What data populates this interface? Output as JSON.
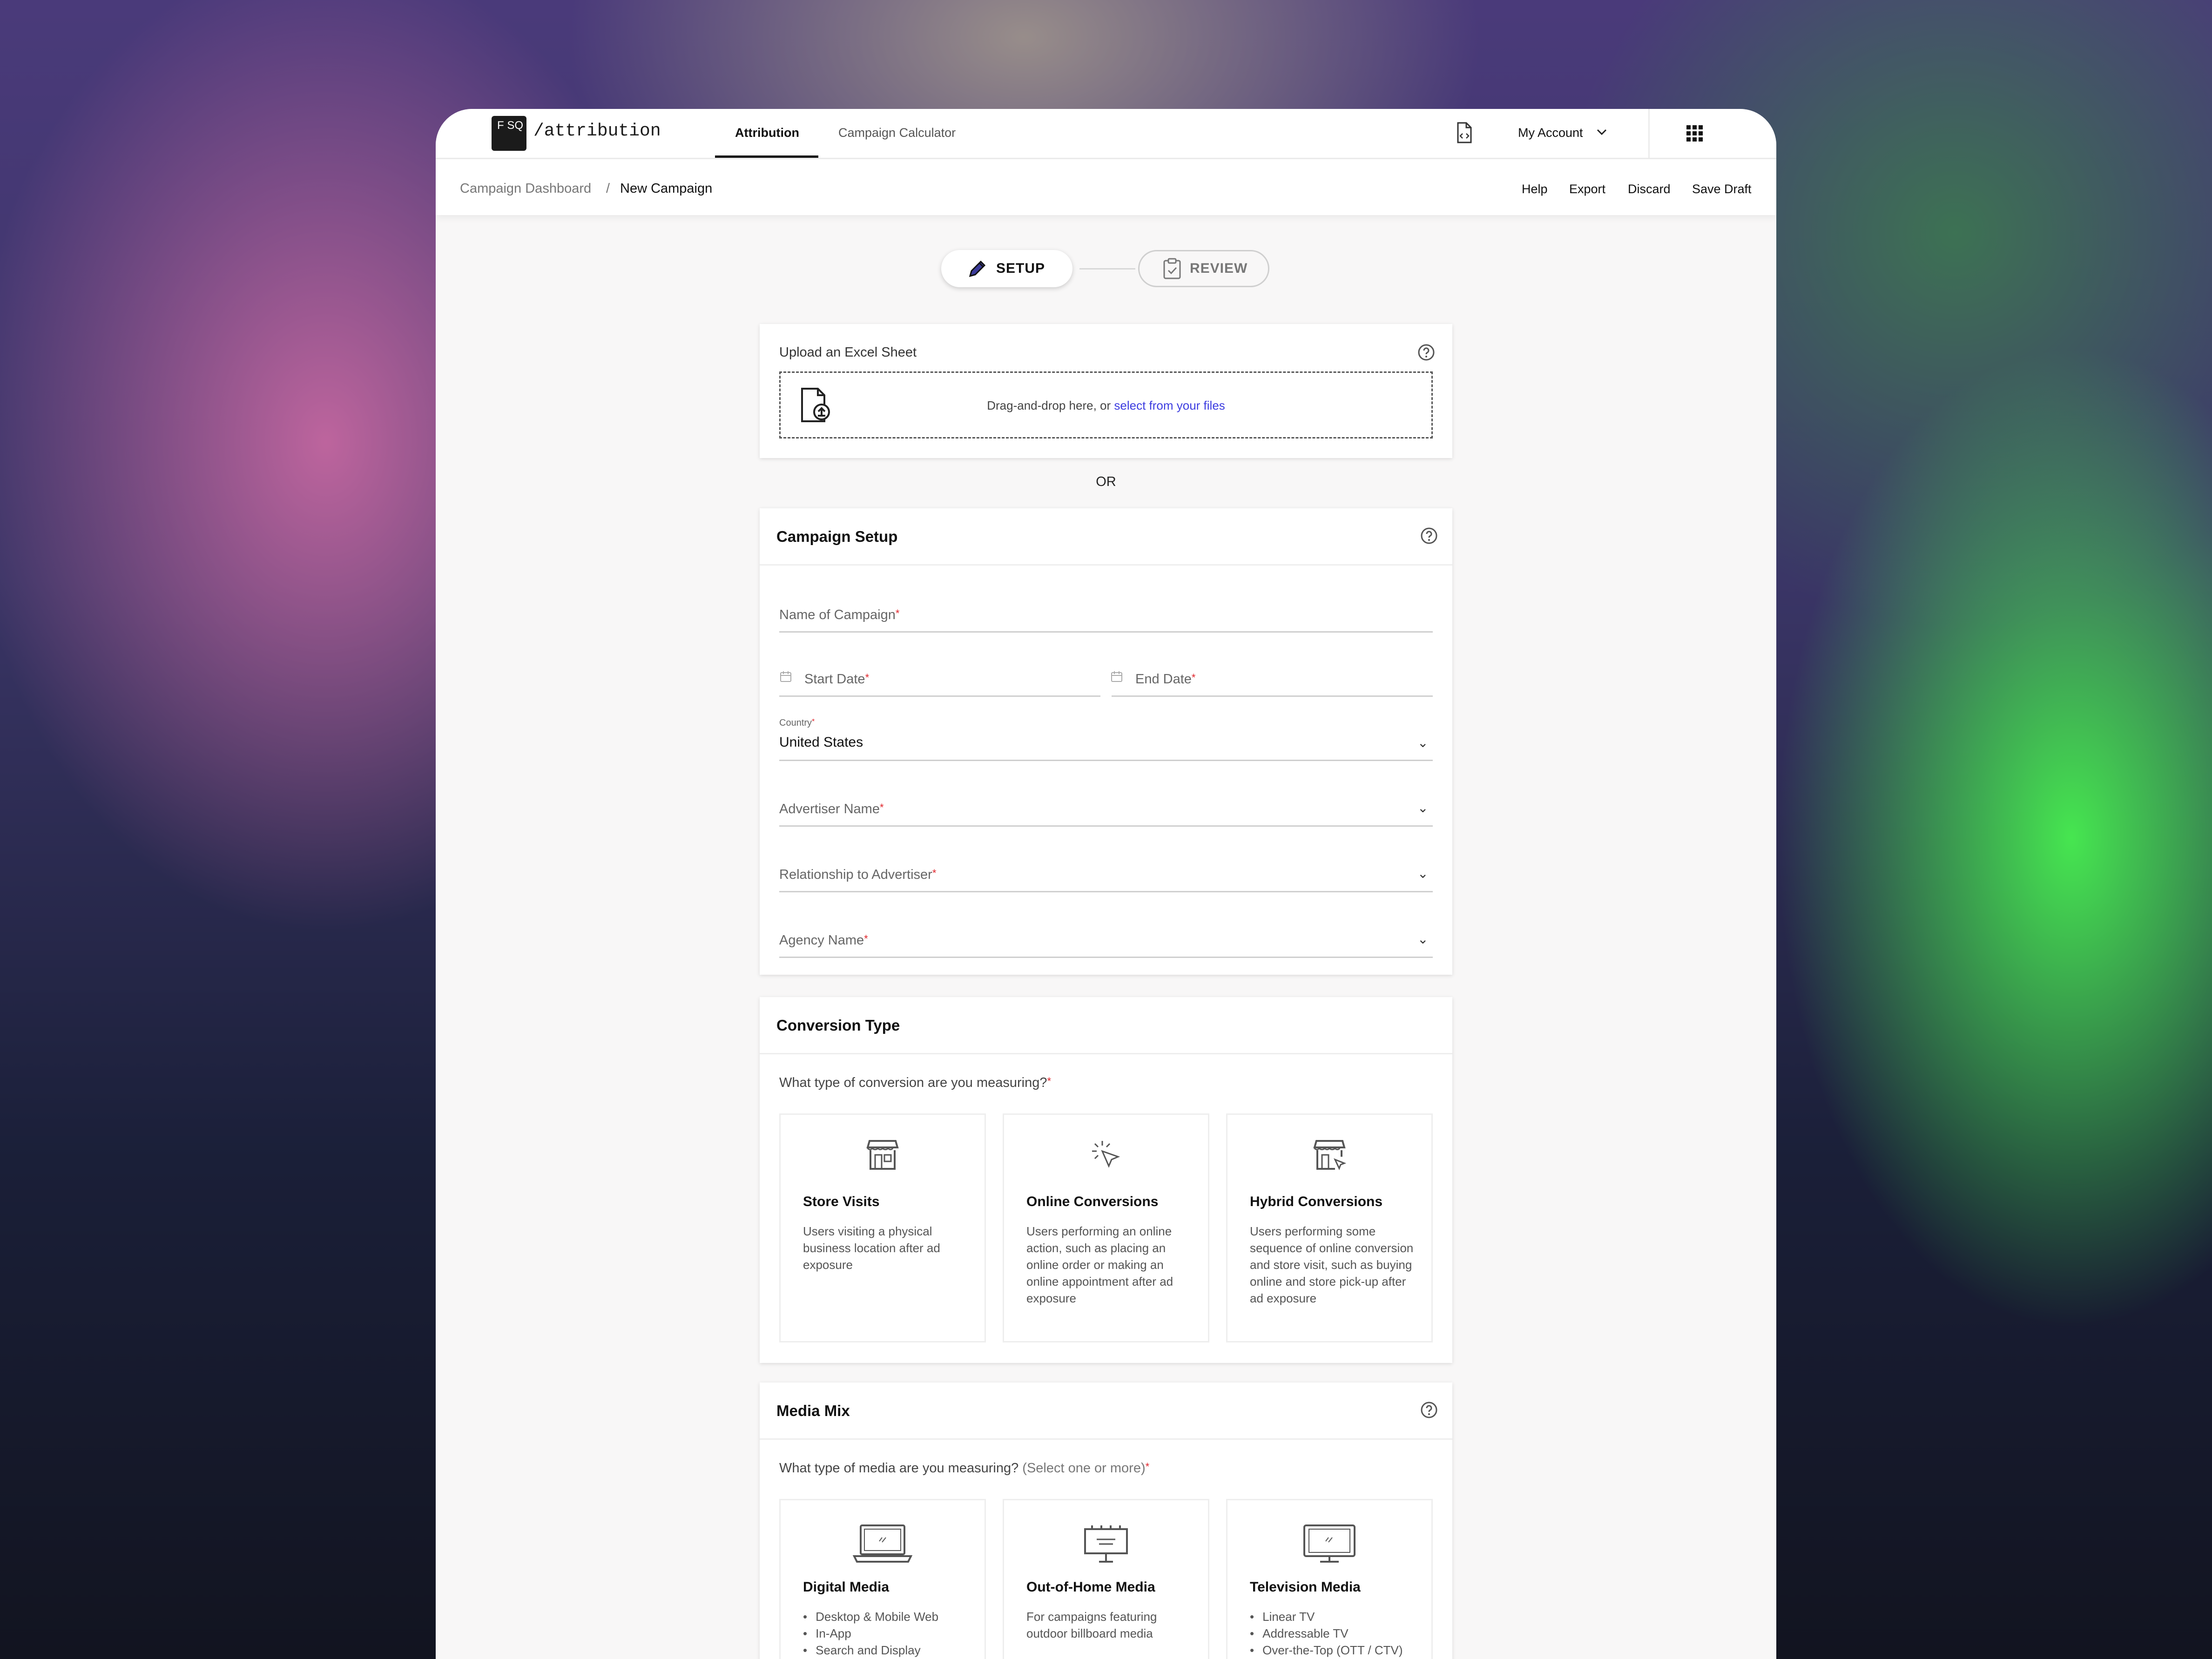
{
  "app": {
    "logo_mark": "F SQ",
    "logo_text": "/attribution"
  },
  "nav": {
    "tabs": [
      {
        "label": "Attribution",
        "active": true
      },
      {
        "label": "Campaign Calculator",
        "active": false
      }
    ],
    "account_label": "My Account"
  },
  "breadcrumb": {
    "parent": "Campaign Dashboard",
    "separator": "/",
    "current": "New Campaign"
  },
  "actions": {
    "help": "Help",
    "export": "Export",
    "discard": "Discard",
    "save_draft": "Save Draft"
  },
  "stepper": {
    "step1": "SETUP",
    "step2": "REVIEW",
    "active_step": 1
  },
  "upload": {
    "title": "Upload an Excel Sheet",
    "drop_text": "Drag-and-drop here, or",
    "link_text": "select from your files",
    "divider": "OR"
  },
  "campaign_setup": {
    "title": "Campaign Setup",
    "name_label": "Name of Campaign",
    "start_label": "Start Date",
    "end_label": "End Date",
    "country_label": "Country",
    "country_value": "United States",
    "advertiser_label": "Advertiser Name",
    "relationship_label": "Relationship to Advertiser",
    "agency_label": "Agency Name",
    "required_mark": "*"
  },
  "conversion": {
    "title": "Conversion Type",
    "question": "What type of conversion are you measuring?",
    "options": [
      {
        "title": "Store Visits",
        "desc": "Users visiting a physical business location after ad exposure",
        "icon": "store-icon"
      },
      {
        "title": "Online Conversions",
        "desc": "Users performing an online action, such as placing an online order or making an online appointment after ad exposure",
        "icon": "cursor-click-icon"
      },
      {
        "title": "Hybrid Conversions",
        "desc": "Users performing some sequence of online conversion and store visit, such as buying online and store pick-up after ad exposure",
        "icon": "store-cursor-icon"
      }
    ]
  },
  "media_mix": {
    "title": "Media Mix",
    "question": "What type of media are you measuring?",
    "hint": "(Select one or more)",
    "options": [
      {
        "title": "Digital Media",
        "icon": "laptop-icon",
        "items": [
          "Desktop & Mobile Web",
          "In-App",
          "Search and Display"
        ]
      },
      {
        "title": "Out-of-Home Media",
        "icon": "billboard-icon",
        "desc": "For campaigns featuring outdoor billboard media"
      },
      {
        "title": "Television Media",
        "icon": "tv-icon",
        "items": [
          "Linear TV",
          "Addressable TV",
          "Over-the-Top (OTT / CTV)"
        ]
      }
    ]
  },
  "colors": {
    "accent_link": "#3d3de0",
    "required": "#e0252b",
    "text": "#111111"
  }
}
